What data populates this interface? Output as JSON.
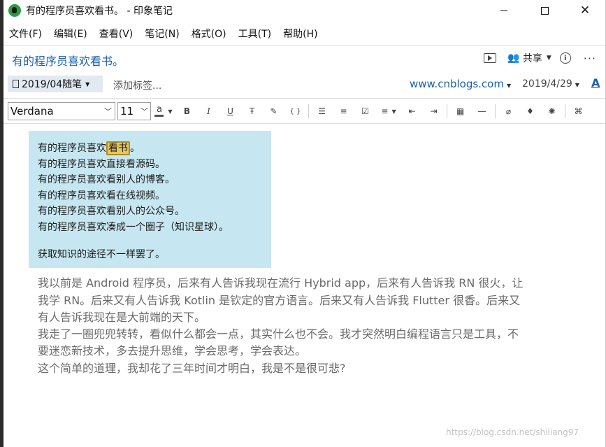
{
  "window": {
    "title": "有的程序员喜欢看书。 - 印象笔记",
    "controls": {
      "minimize": "",
      "maximize": "",
      "close": "✕"
    }
  },
  "menu": [
    "文件(F)",
    "编辑(E)",
    "查看(V)",
    "笔记(N)",
    "格式(O)",
    "工具(T)",
    "帮助(H)"
  ],
  "note": {
    "title": "有的程序员喜欢看书。",
    "share_label": "共享",
    "info_symbol": "i",
    "more_symbol": "···",
    "notebook": "2019/04随笔",
    "add_tags": "添加标签...",
    "source_url": "www.cnblogs.com",
    "date": "2019/4/29",
    "font_link": "A"
  },
  "toolbar": {
    "font": "Verdana",
    "size": "11",
    "buttons": {
      "bold": "B",
      "italic": "I",
      "underline": "U",
      "strike": "Ŧ",
      "highlight": "✎",
      "code": "{ }",
      "bullets": "☰",
      "numbered": "≡",
      "checkbox": "☑",
      "align": "≡",
      "outdent": "⇤",
      "indent": "⇥",
      "table": "▦",
      "hr": "—",
      "attach": "⌀",
      "record": "♦",
      "sketch": "✺",
      "more": "⌘"
    },
    "text_color_letter": "a"
  },
  "body": {
    "quote_lines": [
      "有的程序员喜欢",
      "有的程序员喜欢直接看源码。",
      "有的程序员喜欢看别人的博客。",
      "有的程序员喜欢看在线视频。",
      "有的程序员喜欢看别人的公众号。",
      "有的程序员喜欢凑成一个圈子（知识星球）。",
      "获取知识的途径不一样罢了。"
    ],
    "highlight_word": "看书",
    "first_line_end": "。",
    "paragraph_lines": [
      "我以前是 Android 程序员，后来有人告诉我现在流行 Hybrid app，后来有人告诉我 RN 很火，让",
      "我学 RN。后来又有人告诉我 Kotlin 是钦定的官方语言。后来又有人告诉我 Flutter 很香。后来又",
      "有人告诉我现在是大前端的天下。",
      "我走了一圈兜兜转转，看似什么都会一点，其实什么也不会。我才突然明白编程语言只是工具，不",
      "要迷恋新技术，多去提升思维，学会思考，学会表达。",
      "这个简单的道理，我却花了三年时间才明白，我是不是很可悲?"
    ]
  },
  "watermark": "https://blog.csdn.net/shiliang97",
  "colors": {
    "accent": "#1a5fb4",
    "quote_bg": "#c6e7f1",
    "highlight": "#e6c760"
  }
}
